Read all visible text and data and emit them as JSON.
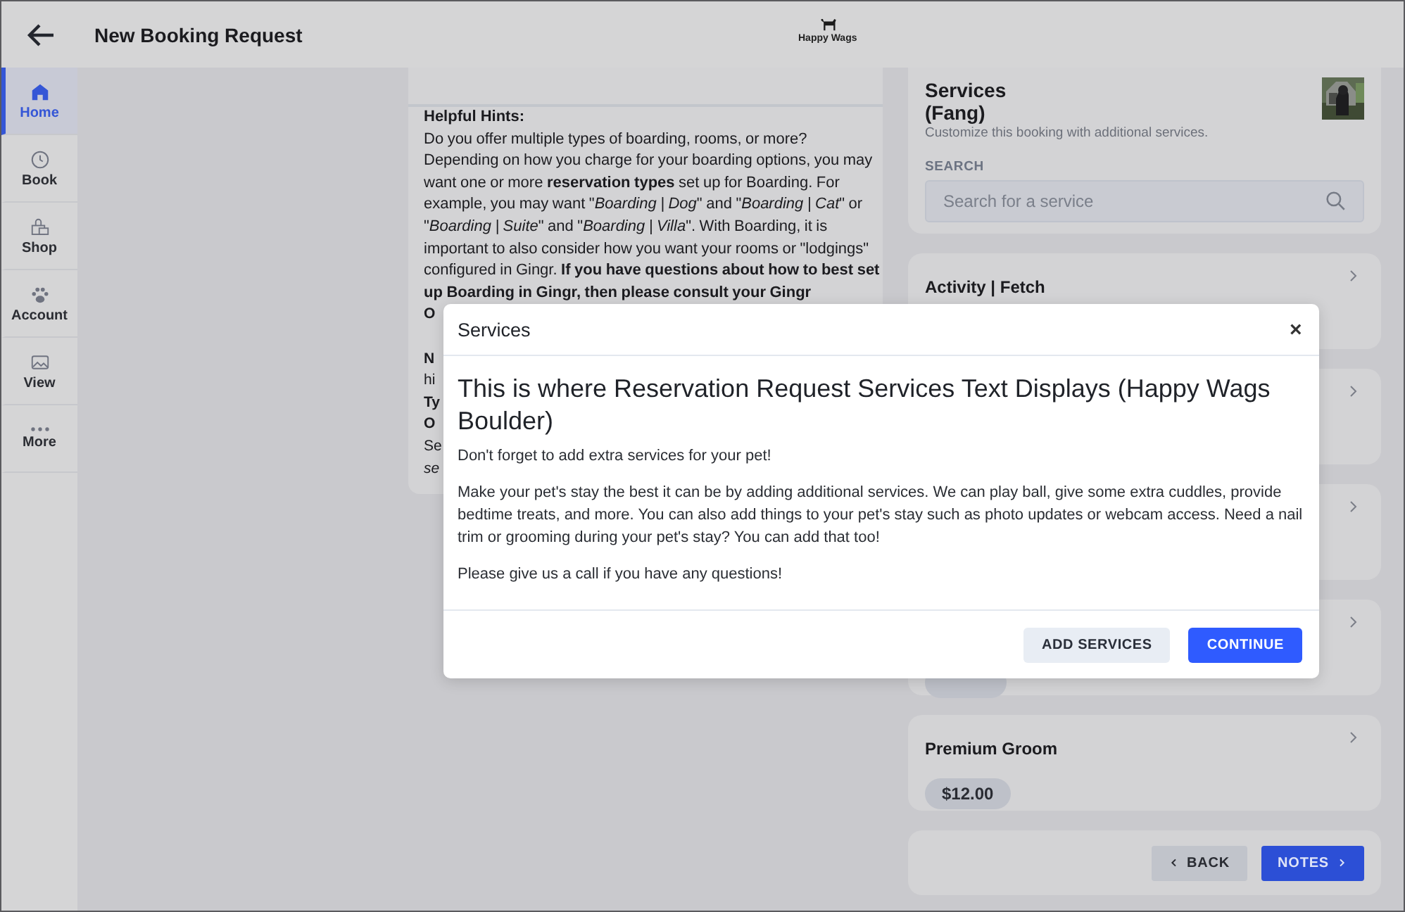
{
  "header": {
    "title": "New Booking Request",
    "logo_text": "Happy Wags"
  },
  "nav": {
    "items": [
      {
        "label": "Home",
        "selected": true
      },
      {
        "label": "Book",
        "selected": false
      },
      {
        "label": "Shop",
        "selected": false
      },
      {
        "label": "Account",
        "selected": false
      },
      {
        "label": "View",
        "selected": false
      },
      {
        "label": "More",
        "selected": false
      }
    ]
  },
  "hints": {
    "heading": "Helpful Hints:",
    "paragraph": "Do you offer multiple types of boarding, rooms, or more? Depending on how you charge for your boarding options, you may want one or more **reservation types** set up for Boarding. For example, you may want \"*Boarding | Dog*\" and \"*Boarding | Cat*\" or \"*Boarding | Suite*\" and \"*Boarding | Villa*\". With Boarding, it is important to also consider how you want your rooms or \"lodgings\" configured in Gingr. **If you have questions about how to best set up Boarding in Gingr, then please consult your Gingr**",
    "fragment_paragraphs": [
      [
        "**O**"
      ],
      [
        "**N**",
        "hi",
        "**Ty**",
        "**O**",
        "Se",
        "*se*"
      ]
    ]
  },
  "services_panel": {
    "title": "Services",
    "pet": "(Fang)",
    "subtitle": "Customize this booking with additional services.",
    "search_label": "SEARCH",
    "search": {
      "placeholder": "Search for a service"
    },
    "cards": [
      {
        "kind": "plain",
        "title": "Activity | Fetch"
      },
      {
        "kind": "plain"
      },
      {
        "kind": "plain"
      },
      {
        "kind": "priced"
      },
      {
        "kind": "priced",
        "title": "Premium Groom",
        "price": "$12.00"
      }
    ],
    "buttons": [
      {
        "label": "BACK",
        "kind": "back"
      },
      {
        "label": "NOTES",
        "kind": "next"
      }
    ]
  },
  "modal": {
    "title": "Services",
    "close": "×",
    "heading": "This is where Reservation Request Services Text Displays (Happy Wags Boulder)",
    "paragraphs": [
      "Don't forget to add extra services for your pet!",
      "Make your pet's stay the best it can be by adding additional services. We can play ball, give some extra cuddles, provide bedtime treats, and more. You can also add things to your pet's stay such as photo updates or webcam access. Need a nail trim or grooming during your pet's stay? You can add that too!",
      "Please give us a call if you have any questions!"
    ],
    "buttons": [
      {
        "label": "ADD SERVICES",
        "kind": "secondary"
      },
      {
        "label": "CONTINUE",
        "kind": "primary"
      }
    ]
  }
}
